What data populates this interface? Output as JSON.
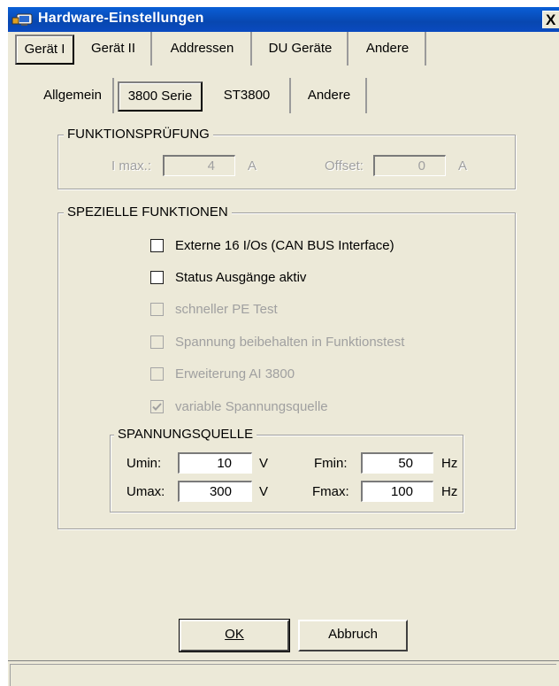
{
  "window": {
    "title": "Hardware-Einstellungen",
    "close_glyph": "X"
  },
  "tabs": [
    "Gerät I",
    "Gerät II",
    "Addressen",
    "DU Geräte",
    "Andere"
  ],
  "subtabs": [
    "Allgemein",
    "3800 Serie",
    "ST3800",
    "Andere"
  ],
  "funktionspruefung": {
    "legend": "FUNKTIONSPRÜFUNG",
    "imax_label": "I max.:",
    "imax_value": "4",
    "imax_unit": "A",
    "offset_label": "Offset:",
    "offset_value": "0",
    "offset_unit": "A"
  },
  "spezielle": {
    "legend": "SPEZIELLE FUNKTIONEN",
    "options": [
      {
        "label": "Externe 16 I/Os (CAN BUS Interface)",
        "checked": false,
        "enabled": true
      },
      {
        "label": "Status Ausgänge aktiv",
        "checked": false,
        "enabled": true
      },
      {
        "label": "schneller PE Test",
        "checked": false,
        "enabled": false
      },
      {
        "label": "Spannung beibehalten in Funktionstest",
        "checked": false,
        "enabled": false
      },
      {
        "label": "Erweiterung AI 3800",
        "checked": false,
        "enabled": false
      },
      {
        "label": "variable Spannungsquelle",
        "checked": true,
        "enabled": false
      }
    ]
  },
  "spannungsquelle": {
    "legend": "SPANNUNGSQUELLE",
    "umin_label": "Umin:",
    "umin_value": "10",
    "umin_unit": "V",
    "umax_label": "Umax:",
    "umax_value": "300",
    "umax_unit": "V",
    "fmin_label": "Fmin:",
    "fmin_value": "50",
    "fmin_unit": "Hz",
    "fmax_label": "Fmax:",
    "fmax_value": "100",
    "fmax_unit": "Hz"
  },
  "buttons": {
    "ok_label": "OK",
    "cancel_label": "Abbruch"
  },
  "colors": {
    "titlebar": "#0847b0",
    "face": "#ece9d8"
  }
}
